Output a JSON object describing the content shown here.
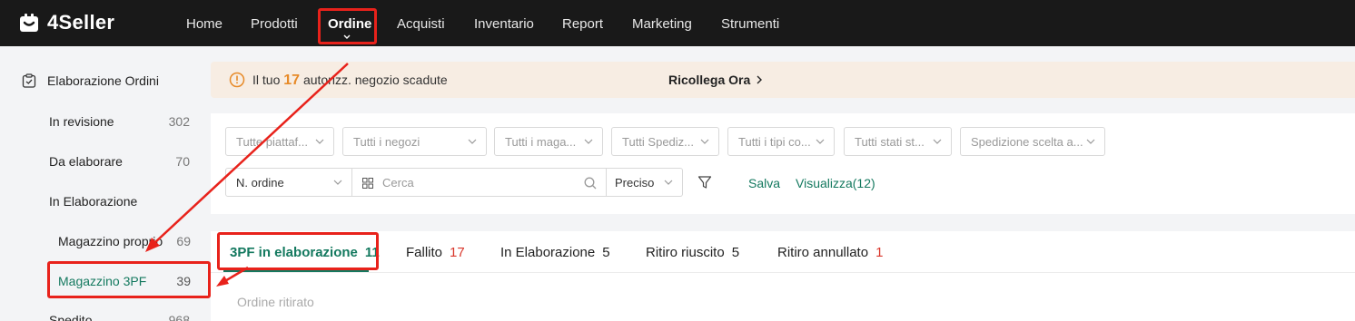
{
  "app": {
    "brand": "4Seller",
    "accent_color": "#14795f",
    "alert_color": "#e78a28",
    "annotation_color": "#e8221b"
  },
  "nav": {
    "items": [
      {
        "label": "Home",
        "active": false
      },
      {
        "label": "Prodotti",
        "active": false
      },
      {
        "label": "Ordine",
        "active": true
      },
      {
        "label": "Acquisti",
        "active": false
      },
      {
        "label": "Inventario",
        "active": false
      },
      {
        "label": "Report",
        "active": false
      },
      {
        "label": "Marketing",
        "active": false
      },
      {
        "label": "Strumenti",
        "active": false
      }
    ]
  },
  "sidebar": {
    "section_title": "Elaborazione Ordini",
    "section_icon": "clipboard-check-icon",
    "items": [
      {
        "label": "In revisione",
        "count": "302"
      },
      {
        "label": "Da elaborare",
        "count": "70"
      },
      {
        "label": "In Elaborazione",
        "count": ""
      },
      {
        "label": "Magazzino proprio",
        "count": "69"
      },
      {
        "label": "Magazzino 3PF",
        "count": "39",
        "selected": true
      },
      {
        "label": "Spedito",
        "count": "968"
      }
    ]
  },
  "alert": {
    "icon": "warning-circle-icon",
    "prefix": "Il tuo",
    "number": "17",
    "suffix": "autorizz. negozio scadute",
    "link": "Ricollega Ora"
  },
  "filters": {
    "dropdowns": [
      {
        "placeholder": "Tutte piattaf..."
      },
      {
        "placeholder": "Tutti i negozi"
      },
      {
        "placeholder": "Tutti i maga..."
      },
      {
        "placeholder": "Tutti Spediz..."
      },
      {
        "placeholder": "Tutti i tipi co..."
      },
      {
        "placeholder": "Tutti stati st..."
      },
      {
        "placeholder": "Spedizione scelta a..."
      }
    ],
    "order_field": "N. ordine",
    "search_placeholder": "Cerca",
    "match_mode": "Preciso",
    "save_label": "Salva",
    "view_label": "Visualizza(12)"
  },
  "tabs": [
    {
      "label": "3PF in elaborazione",
      "count": "11",
      "active": true
    },
    {
      "label": "Fallito",
      "count": "17",
      "count_red": true
    },
    {
      "label": "In Elaborazione",
      "count": "5"
    },
    {
      "label": "Ritiro riuscito",
      "count": "5"
    },
    {
      "label": "Ritiro annullato",
      "count": "1",
      "count_red": true
    }
  ],
  "subtab": {
    "label": "Ordine ritirato"
  }
}
